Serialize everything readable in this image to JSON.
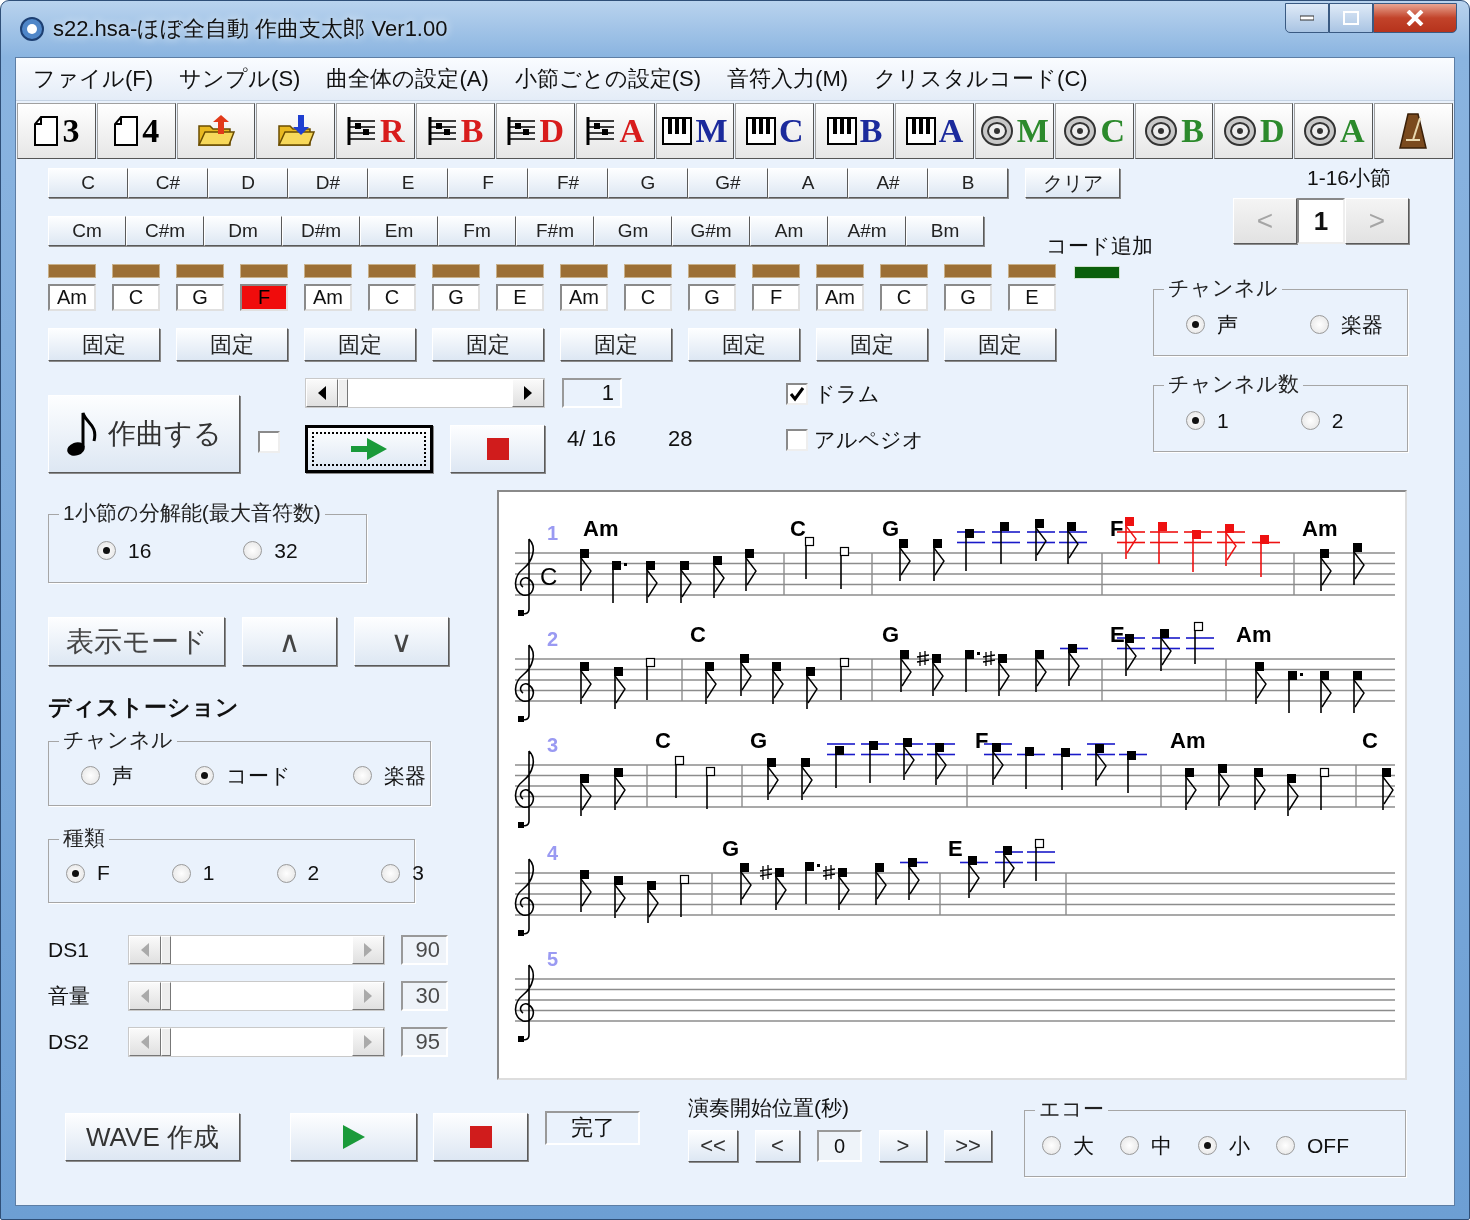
{
  "window": {
    "title": "s22.hsa-ほぼ全自動 作曲支太郎 Ver1.00"
  },
  "menu": [
    "ファイル(F)",
    "サンプル(S)",
    "曲全体の設定(A)",
    "小節ごとの設定(S)",
    "音符入力(M)",
    "クリスタルコード(C)"
  ],
  "toolbar": [
    {
      "kind": "page",
      "label": "3"
    },
    {
      "kind": "page",
      "label": "4"
    },
    {
      "kind": "open"
    },
    {
      "kind": "save"
    },
    {
      "kind": "score",
      "label": "R"
    },
    {
      "kind": "score",
      "label": "B"
    },
    {
      "kind": "score",
      "label": "D"
    },
    {
      "kind": "score",
      "label": "A"
    },
    {
      "kind": "keys",
      "label": "M"
    },
    {
      "kind": "keys",
      "label": "C"
    },
    {
      "kind": "keys",
      "label": "B"
    },
    {
      "kind": "keys",
      "label": "A"
    },
    {
      "kind": "disc",
      "label": "M"
    },
    {
      "kind": "disc",
      "label": "C"
    },
    {
      "kind": "disc",
      "label": "B"
    },
    {
      "kind": "disc",
      "label": "D"
    },
    {
      "kind": "disc",
      "label": "A"
    },
    {
      "kind": "metronome"
    }
  ],
  "chords": {
    "major": [
      "C",
      "C#",
      "D",
      "D#",
      "E",
      "F",
      "F#",
      "G",
      "G#",
      "A",
      "A#",
      "B"
    ],
    "minor": [
      "Cm",
      "C#m",
      "Dm",
      "D#m",
      "Em",
      "Fm",
      "F#m",
      "Gm",
      "G#m",
      "Am",
      "A#m",
      "Bm"
    ],
    "clear": "クリア",
    "add_label": "コード追加"
  },
  "bars": {
    "range": "1-16小節",
    "prev": {
      "label": "<",
      "disabled": true
    },
    "current": "1",
    "next": {
      "label": ">",
      "disabled": true
    }
  },
  "slots": [
    {
      "chord": "Am",
      "selected": false
    },
    {
      "chord": "C",
      "selected": false
    },
    {
      "chord": "G",
      "selected": false
    },
    {
      "chord": "F",
      "selected": true
    },
    {
      "chord": "Am",
      "selected": false
    },
    {
      "chord": "C",
      "selected": false
    },
    {
      "chord": "G",
      "selected": false
    },
    {
      "chord": "E",
      "selected": false
    },
    {
      "chord": "Am",
      "selected": false
    },
    {
      "chord": "C",
      "selected": false
    },
    {
      "chord": "G",
      "selected": false
    },
    {
      "chord": "F",
      "selected": false
    },
    {
      "chord": "Am",
      "selected": false
    },
    {
      "chord": "C",
      "selected": false
    },
    {
      "chord": "G",
      "selected": false
    },
    {
      "chord": "E",
      "selected": false
    }
  ],
  "fix_buttons": [
    "固定",
    "固定",
    "固定",
    "固定",
    "固定",
    "固定",
    "固定",
    "固定"
  ],
  "channel": {
    "title": "チャンネル",
    "options": [
      {
        "label": "声",
        "selected": true
      },
      {
        "label": "楽器",
        "selected": false
      }
    ]
  },
  "compose": {
    "label": "作曲する",
    "checked": false
  },
  "transport": {
    "level": 0,
    "play_focused": true,
    "counter": "1",
    "position": "4/ 16",
    "count": "28"
  },
  "options": [
    {
      "label": "ドラム",
      "checked": true
    },
    {
      "label": "アルペジオ",
      "checked": false
    }
  ],
  "channel_count": {
    "title": "チャンネル数",
    "options": [
      {
        "label": "1",
        "selected": true
      },
      {
        "label": "2",
        "selected": false
      }
    ]
  },
  "resolution": {
    "title": "1小節の分解能(最大音符数)",
    "options": [
      {
        "label": "16",
        "selected": true
      },
      {
        "label": "32",
        "selected": false
      }
    ]
  },
  "view_buttons": [
    "表示モード",
    "∧",
    "∨"
  ],
  "distortion": {
    "title": "ディストーション",
    "channel": {
      "title": "チャンネル",
      "options": [
        {
          "label": "声",
          "selected": false
        },
        {
          "label": "コード",
          "selected": true
        },
        {
          "label": "楽器",
          "selected": false
        }
      ]
    },
    "type": {
      "title": "種類",
      "options": [
        {
          "label": "F",
          "selected": true
        },
        {
          "label": "1",
          "selected": false
        },
        {
          "label": "2",
          "selected": false
        },
        {
          "label": "3",
          "selected": false
        }
      ]
    },
    "sliders": [
      {
        "label": "DS1",
        "level": 0,
        "value": "90"
      },
      {
        "label": "音量",
        "level": 0,
        "value": "30"
      },
      {
        "label": "DS2",
        "level": 0,
        "value": "95"
      }
    ]
  },
  "score": {
    "time_signature": "C",
    "systems": [
      {
        "number": "1",
        "chords": [
          "Am",
          "C",
          "G",
          "F",
          "Am"
        ]
      },
      {
        "number": "2",
        "chords": [
          "C",
          "G",
          "E",
          "Am"
        ]
      },
      {
        "number": "3",
        "chords": [
          "C",
          "G",
          "F",
          "Am",
          "C"
        ]
      },
      {
        "number": "4",
        "chords": [
          "G",
          "E"
        ]
      },
      {
        "number": "5"
      }
    ]
  },
  "wave": {
    "button": "WAVE 作成",
    "status": "完了"
  },
  "start_position": {
    "title": "演奏開始位置(秒)",
    "before": [
      "<<",
      "<"
    ],
    "value": "0",
    "after": [
      ">",
      ">>"
    ]
  },
  "echo": {
    "title": "エコー",
    "options": [
      {
        "label": "大",
        "selected": false
      },
      {
        "label": "中",
        "selected": false
      },
      {
        "label": "小",
        "selected": true
      },
      {
        "label": "OFF",
        "selected": false
      }
    ]
  }
}
